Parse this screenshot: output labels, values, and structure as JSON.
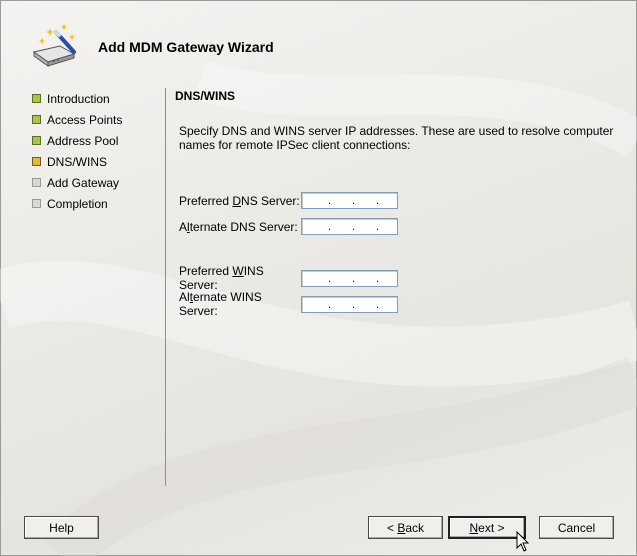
{
  "wizard": {
    "title": "Add MDM Gateway Wizard"
  },
  "steps": [
    {
      "label": "Introduction",
      "state": "done"
    },
    {
      "label": "Access Points",
      "state": "done"
    },
    {
      "label": "Address Pool",
      "state": "done"
    },
    {
      "label": "DNS/WINS",
      "state": "current"
    },
    {
      "label": "Add Gateway",
      "state": "pending"
    },
    {
      "label": "Completion",
      "state": "pending"
    }
  ],
  "page": {
    "section_title": "DNS/WINS",
    "description": "Specify DNS and WINS server IP addresses. These are used to resolve computer names for remote IPSec client connections:"
  },
  "fields": {
    "preferred_dns": {
      "label_pre": "Preferred ",
      "label_u": "D",
      "label_post": "NS Server:",
      "value": ". . ."
    },
    "alternate_dns": {
      "label_pre": "A",
      "label_u": "l",
      "label_post": "ternate DNS Server:",
      "value": ". . ."
    },
    "preferred_wins": {
      "label_pre": "Preferred ",
      "label_u": "W",
      "label_post": "INS Server:",
      "value": ". . ."
    },
    "alternate_wins": {
      "label_pre": "Al",
      "label_u": "t",
      "label_post": "ernate WINS Server:",
      "value": ". . ."
    }
  },
  "buttons": {
    "help": "Help",
    "back_pre": "< ",
    "back_u": "B",
    "back_post": "ack",
    "next_u": "N",
    "next_post": "ext >",
    "cancel": "Cancel"
  },
  "colors": {
    "done": "#a8c64a",
    "current": "#e8b63c",
    "pending": "#d8d8d8"
  }
}
